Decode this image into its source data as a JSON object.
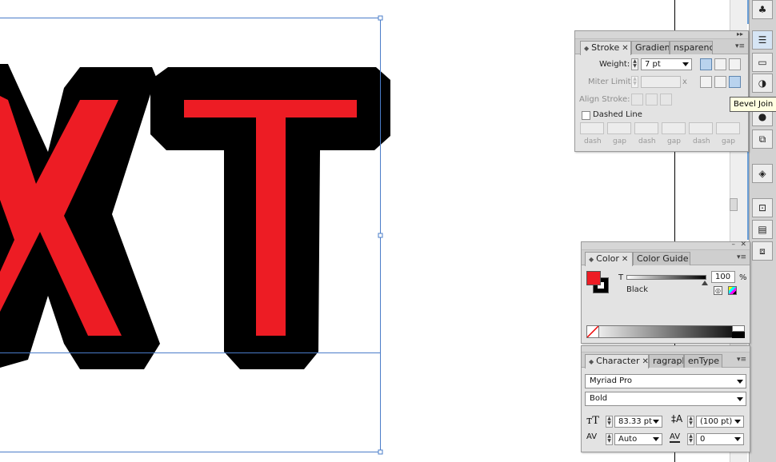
{
  "canvas": {
    "text_fill": "#ed1c24",
    "stroke_color": "#000000",
    "selection_color": "#4a7cc9",
    "letters": [
      "X",
      "T"
    ]
  },
  "stroke_panel": {
    "tabs": [
      {
        "label": "Stroke",
        "active": true
      },
      {
        "label": "Gradient",
        "active": false
      },
      {
        "label": "nsparency",
        "active": false
      }
    ],
    "weight_label": "Weight:",
    "weight_value": "7 pt",
    "miter_label": "Miter Limit:",
    "miter_suffix": "x",
    "align_label": "Align Stroke:",
    "dashed_label": "Dashed Line",
    "dashed_checked": false,
    "dash_labels": [
      "dash",
      "gap",
      "dash",
      "gap",
      "dash",
      "gap"
    ],
    "active_join": "bevel-join"
  },
  "tooltip": {
    "text": "Bevel Join"
  },
  "color_panel": {
    "tabs": [
      {
        "label": "Color",
        "active": true
      },
      {
        "label": "Color Guide",
        "active": false
      }
    ],
    "channel_label": "T",
    "channel_value": "100",
    "percent": "%",
    "color_name": "Black",
    "fill_color": "#ed1c24",
    "stroke_color": "#000000"
  },
  "character_panel": {
    "tabs": [
      {
        "label": "Character",
        "active": true
      },
      {
        "label": "ragraph",
        "active": false
      },
      {
        "label": "enType",
        "active": false
      }
    ],
    "font_family": "Myriad Pro",
    "font_style": "Bold",
    "font_size": "83.33 pt",
    "leading": "(100 pt)",
    "kerning": "Auto",
    "tracking": "0"
  },
  "dock": {
    "icons": [
      "club-icon",
      "stroke-icon",
      "gradient-icon",
      "transparency-icon",
      "appearance-icon",
      "graphic-styles-icon",
      "layers-icon",
      "artboards-icon",
      "align-icon",
      "pathfinder-icon"
    ]
  }
}
